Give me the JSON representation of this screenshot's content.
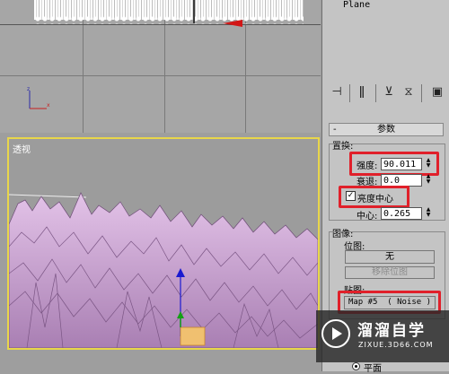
{
  "object_list": {
    "selected": "Plane"
  },
  "toolbar": {
    "icons": [
      "pin-stack-icon",
      "modifier-stack-icon",
      "make-unique-icon",
      "remove-modifier-icon",
      "configure-sets-icon"
    ]
  },
  "rollout": {
    "title": "参数",
    "collapse": "-"
  },
  "transform": {
    "group_label": "置换:",
    "strength_label": "强度:",
    "strength_value": "90.011",
    "decay_label": "衰退:",
    "decay_value": "0.0",
    "center_lum_label": "亮度中心",
    "center_label": "中心:",
    "center_value": "0.265"
  },
  "image": {
    "group_label": "图像:",
    "bitmap_label": "位图:",
    "none_button": "无",
    "remove_bitmap_button": "移除位图",
    "map_label": "贴图:",
    "map_button": "Map #5  ( Noise )"
  },
  "mapping": {
    "planar_label": "平面"
  },
  "viewport": {
    "perspective_label": "透视"
  },
  "watermark": {
    "title": "溜溜自学",
    "url": "ZIXUE.3D66.COM"
  },
  "colors": {
    "highlight": "#e0202a",
    "active_viewport": "#e8d64a",
    "terrain": "#d3a8da"
  }
}
